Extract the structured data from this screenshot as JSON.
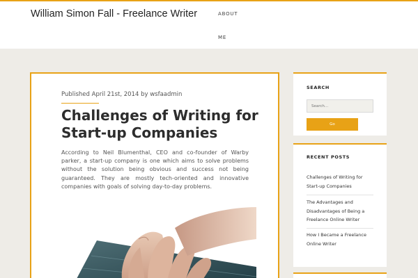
{
  "header": {
    "site_title": "William Simon Fall - Freelance Writer",
    "nav": [
      {
        "label": "ABOUT"
      },
      {
        "label": "ME"
      }
    ]
  },
  "post": {
    "meta": "Published April 21st, 2014 by wsfaadmin",
    "title": "Challenges of Writing for Start-up Companies",
    "excerpt": "According to Neil Blumenthal, CEO and co-founder of Warby parker, a start-up company is one which aims to solve problems without the solution being obvious and success not being guaranteed. They are mostly tech-oriented and innovative companies with goals of solving day-to-day problems."
  },
  "sidebar": {
    "search": {
      "title": "SEARCH",
      "placeholder": "Search...",
      "button": "Go"
    },
    "recent": {
      "title": "RECENT POSTS",
      "items": [
        {
          "label": "Challenges of Writing for Start-up Companies"
        },
        {
          "label": "The Advantages and Disadvantages of Being a Freelance Online Writer"
        },
        {
          "label": "How I Became a Freelance Online Writer"
        }
      ]
    }
  },
  "colors": {
    "accent": "#e8a216",
    "page_bg": "#eeece7"
  }
}
